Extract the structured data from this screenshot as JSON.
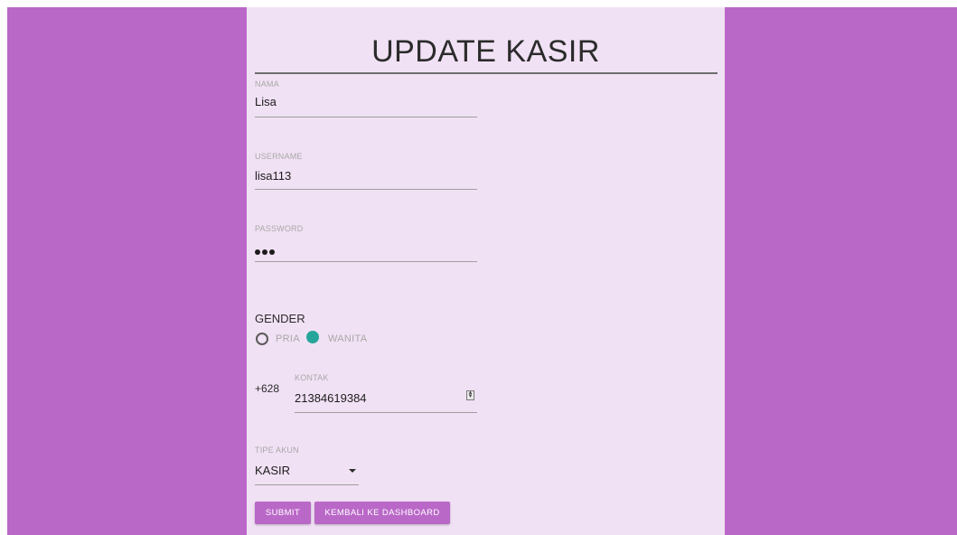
{
  "page": {
    "title": "UPDATE KASIR"
  },
  "form": {
    "nama": {
      "label": "NAMA",
      "value": "Lisa"
    },
    "username": {
      "label": "USERNAME",
      "value": "lisa113"
    },
    "password": {
      "label": "PASSWORD",
      "masked_length": 3
    },
    "gender": {
      "title": "GENDER",
      "options": [
        {
          "label": "PRIA",
          "selected": false
        },
        {
          "label": "WANITA",
          "selected": true
        }
      ]
    },
    "kontak": {
      "prefix": "+628",
      "label": "KONTAK",
      "value": "21384619384"
    },
    "tipe_akun": {
      "label": "TIPE AKUN",
      "value": "KASIR"
    }
  },
  "actions": {
    "submit_label": "SUBMIT",
    "back_label": "KEMBALI KE DASHBOARD"
  },
  "colors": {
    "accent": "#ba68c8",
    "panel_bg": "#f1e1f4",
    "radio_selected": "#26a69a"
  },
  "icons": {
    "dropdown": "caret-down-icon",
    "number_spinner": "spinner-icon"
  }
}
